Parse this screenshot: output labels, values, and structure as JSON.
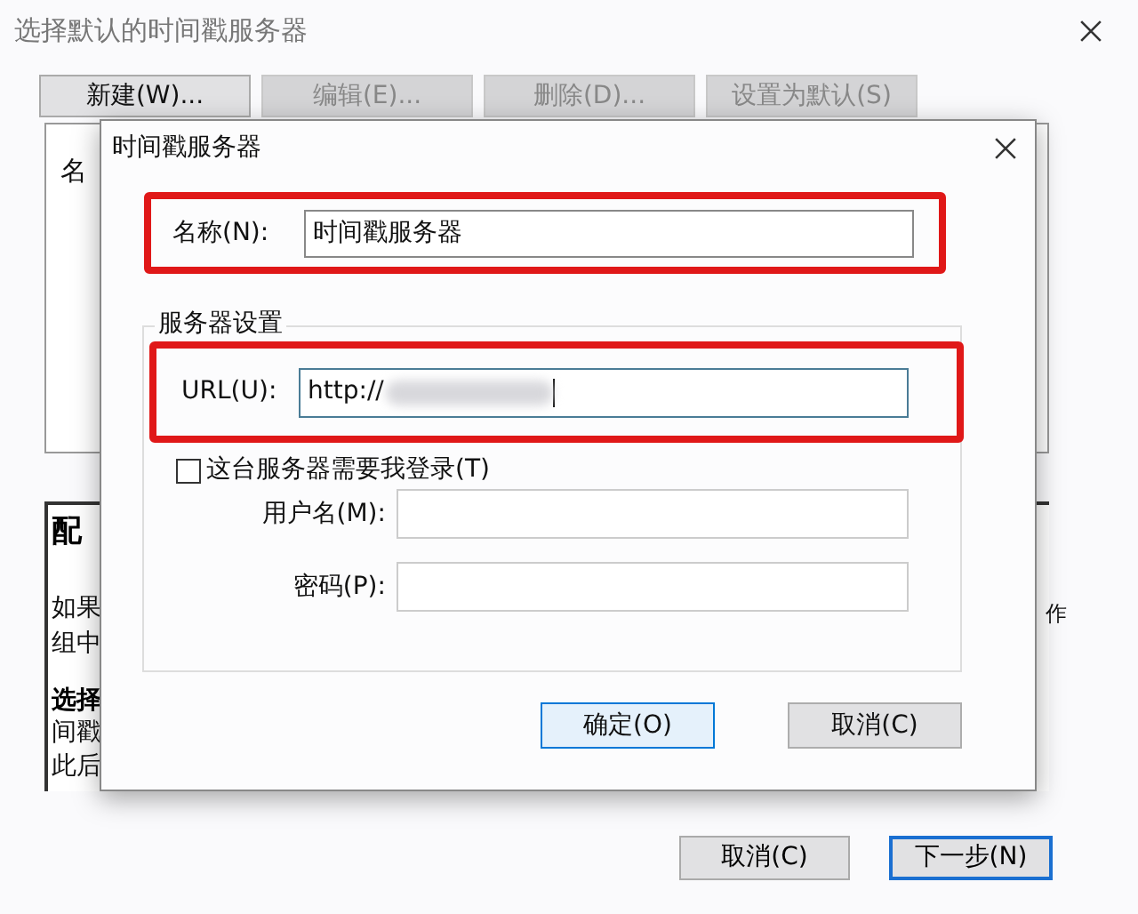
{
  "window": {
    "title": "选择默认的时间戳服务器",
    "toolbar": [
      {
        "label": "新建(W)...",
        "disabled": false
      },
      {
        "label": "编辑(E)...",
        "disabled": true
      },
      {
        "label": "删除(D)...",
        "disabled": true
      },
      {
        "label": "设置为默认(S)",
        "disabled": true
      }
    ],
    "list_header": "名",
    "info_panel": {
      "heading": "配",
      "lines": [
        "如果",
        "组中"
      ],
      "subheading": "选择",
      "more_lines": [
        "间戳",
        "此后"
      ],
      "right_fragment": "作"
    },
    "buttons": [
      {
        "label": "取消(C)",
        "default": false
      },
      {
        "label": "下一步(N)",
        "default": true
      }
    ]
  },
  "dialog": {
    "title": "时间戳服务器",
    "name_field": {
      "label": "名称(N):",
      "value": "时间戳服务器",
      "highlighted": true
    },
    "group": {
      "title": "服务器设置",
      "url_field": {
        "label": "URL(U):",
        "value": "http://",
        "highlighted": true
      },
      "login_checkbox": {
        "label": "这台服务器需要我登录(T)",
        "checked": false
      },
      "username_field": {
        "label": "用户名(M):"
      },
      "password_field": {
        "label": "密码(P):"
      }
    },
    "buttons": [
      {
        "label": "确定(O)",
        "default": true
      },
      {
        "label": "取消(C)",
        "default": false
      }
    ]
  }
}
